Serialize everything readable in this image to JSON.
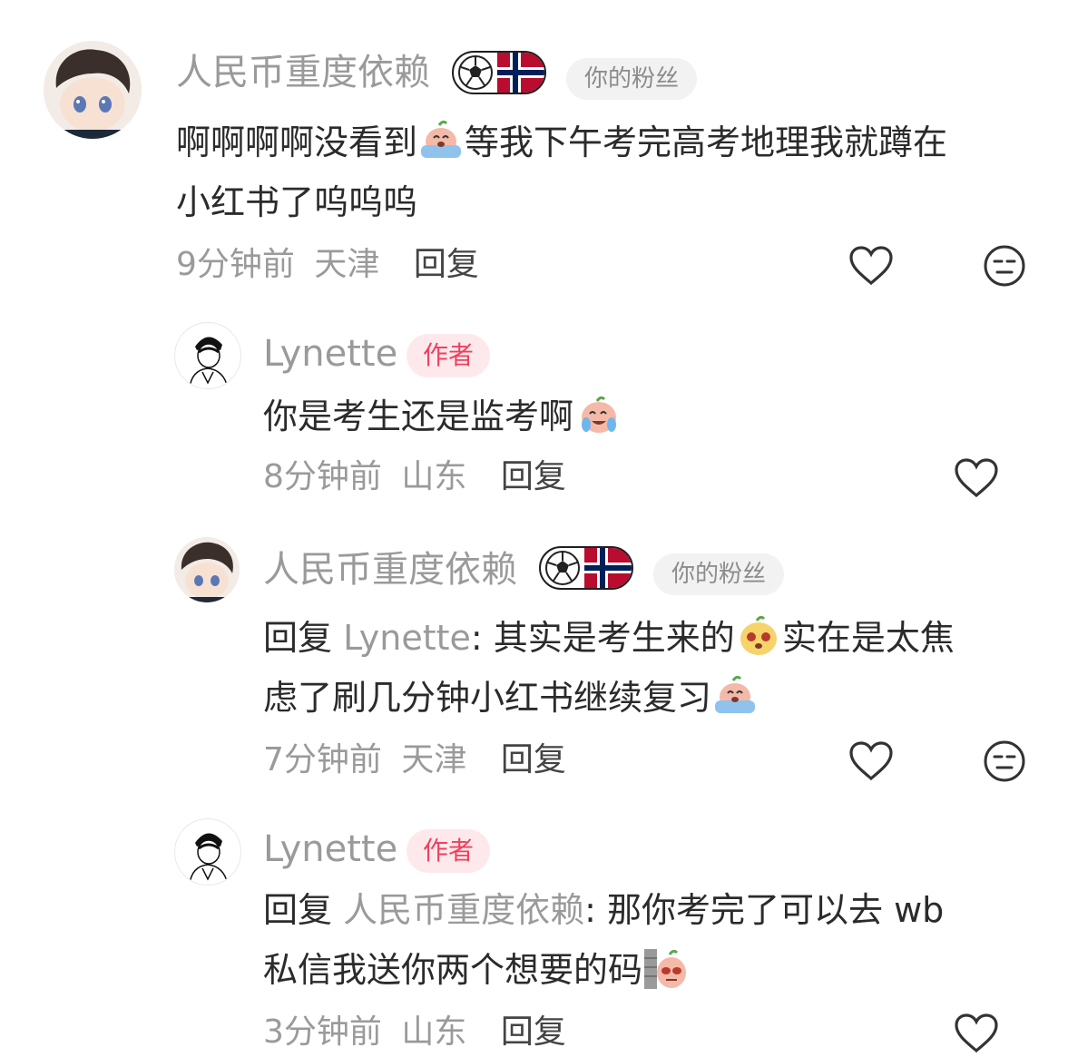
{
  "comments": [
    {
      "username": "人民币重度依赖",
      "fan_tag": "你的粉丝",
      "badge_icons": [
        "soccer-ball-icon",
        "norway-flag-icon"
      ],
      "text_parts": [
        "啊啊啊啊没看到",
        "等我下午考完高考地理我就蹲在",
        "小红书了呜呜呜"
      ],
      "time": "9分钟前",
      "location": "天津",
      "reply_label": "回复"
    },
    {
      "username": "Lynette",
      "author_tag": "作者",
      "text_parts": [
        "你是考生还是监考啊"
      ],
      "time": "8分钟前",
      "location": "山东",
      "reply_label": "回复"
    },
    {
      "username": "人民币重度依赖",
      "fan_tag": "你的粉丝",
      "badge_icons": [
        "soccer-ball-icon",
        "norway-flag-icon"
      ],
      "reply_prefix": "回复",
      "reply_to": "Lynette",
      "text_parts": [
        ": 其实是考生来的",
        "实在是太焦",
        "虑了刷几分钟小红书继续复习"
      ],
      "time": "7分钟前",
      "location": "天津",
      "reply_label": "回复"
    },
    {
      "username": "Lynette",
      "author_tag": "作者",
      "reply_prefix": "回复",
      "reply_to": "人民币重度依赖",
      "text_parts": [
        ": 那你考完了可以去 wb",
        "私信我送你两个想要的码"
      ],
      "time": "3分钟前",
      "location": "山东",
      "reply_label": "回复"
    }
  ],
  "colors": {
    "name": "#9a9a9a",
    "author_tag_text": "#f0405e",
    "author_tag_bg": "#fde9ec",
    "fan_tag_bg": "#f2f2f2",
    "body_text": "#2b2b2b"
  }
}
